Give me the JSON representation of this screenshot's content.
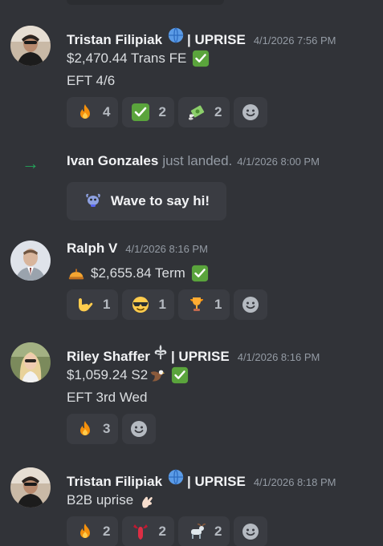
{
  "messages": [
    {
      "username": "Tristan Filipiak",
      "tag": "| UPRISE",
      "timestamp": "4/1/2026 7:56 PM",
      "line1_text": "$2,470.44 Trans FE",
      "line2_text": "EFT 4/6",
      "reactions": [
        {
          "emoji": "fire-emoji",
          "count": "4"
        },
        {
          "emoji": "check-emoji",
          "count": "2"
        },
        {
          "emoji": "money-wings-emoji",
          "count": "2"
        }
      ]
    },
    {
      "username": "Ralph V",
      "timestamp": "4/1/2026 8:16 PM",
      "line1_text": "$2,655.84 Term",
      "reactions": [
        {
          "emoji": "call-me-hand-emoji",
          "count": "1"
        },
        {
          "emoji": "sunglasses-emoji",
          "count": "1"
        },
        {
          "emoji": "trophy-emoji",
          "count": "1"
        }
      ]
    },
    {
      "username": "Riley Shaffer",
      "tag": "| UPRISE",
      "timestamp": "4/1/2026 8:16 PM",
      "line1_text": "$1,059.24 S2",
      "line2_text": "EFT 3rd Wed",
      "reactions": [
        {
          "emoji": "fire-emoji",
          "count": "3"
        }
      ]
    },
    {
      "username": "Tristan Filipiak",
      "tag": "| UPRISE",
      "timestamp": "4/1/2026 8:18 PM",
      "line1_text": "B2B uprise",
      "reactions": [
        {
          "emoji": "fire-emoji",
          "count": "2"
        },
        {
          "emoji": "lobster-emoji",
          "count": "2"
        },
        {
          "emoji": "goat-emoji",
          "count": "2"
        }
      ]
    }
  ],
  "join": {
    "username": "Ivan Gonzales",
    "text": "just landed.",
    "timestamp": "4/1/2026 8:00 PM",
    "wave_label": "Wave to say hi!"
  },
  "colors": {
    "background": "#313338",
    "reaction_bg": "#3a3c42",
    "username": "#f2f3f5",
    "timestamp": "#949ba4",
    "join_arrow": "#23a55a"
  }
}
